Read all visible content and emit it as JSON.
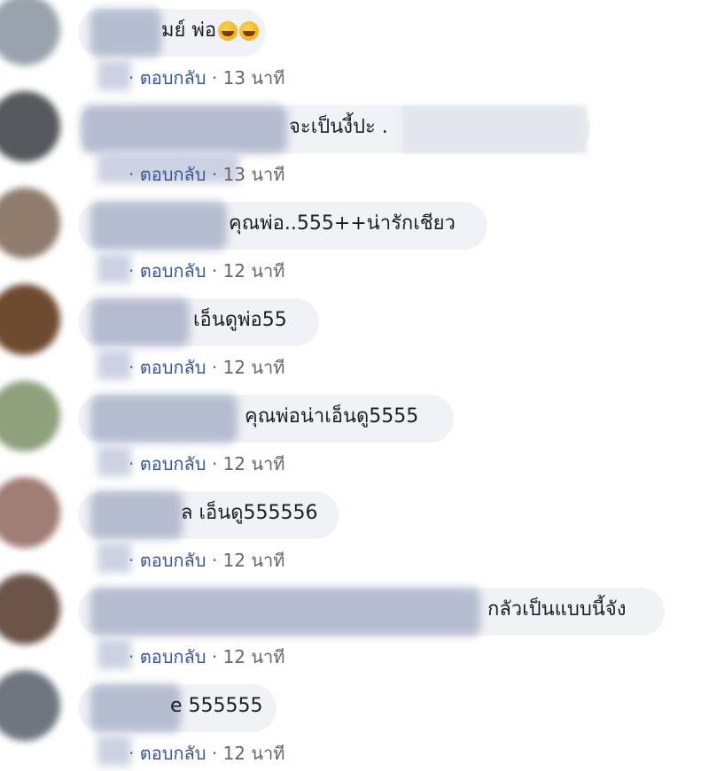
{
  "colors": {
    "bubble": "#f0f2f5",
    "meta": "#65676b",
    "reply_link": "#385898",
    "text": "#1c1e21"
  },
  "reply_label": "ตอบกลับ",
  "separator": "·",
  "comments": [
    {
      "text": "มย์ พ่อ",
      "emoji": [
        "rolling-laughing-emoji",
        "rolling-laughing-emoji"
      ],
      "time": "13 นาที"
    },
    {
      "text": "จะเป็นงี้ปะ .",
      "time": "13 นาที"
    },
    {
      "text": "คุณพ่อ..555++น่ารักเชียว",
      "time": "12 นาที"
    },
    {
      "text": "เอ็นดูพ่อ55",
      "time": "12 นาที"
    },
    {
      "text": "คุณพ่อน่าเอ็นดู5555",
      "time": "12 นาที"
    },
    {
      "text": "ล เอ็นดู555556",
      "time": "12 นาที"
    },
    {
      "text": "กลัวเป็นแบบนี้จัง",
      "time": "12 นาที"
    },
    {
      "text": "e 555555",
      "time": "12 นาที"
    }
  ]
}
